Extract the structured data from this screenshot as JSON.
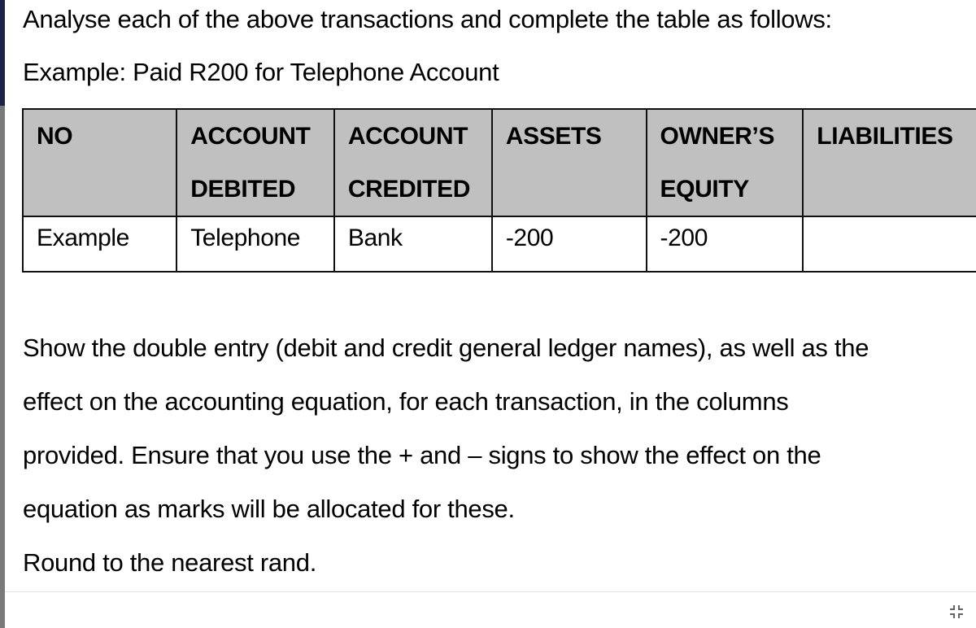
{
  "document": {
    "instruction": "Analyse each of the above transactions and complete the table as follows:",
    "example_caption": "Example: Paid R200 for Telephone Account",
    "table": {
      "headers": [
        [
          "NO",
          ""
        ],
        [
          "ACCOUNT",
          "DEBITED"
        ],
        [
          "ACCOUNT",
          "CREDITED"
        ],
        [
          "ASSETS",
          ""
        ],
        [
          "OWNER’S",
          "EQUITY"
        ],
        [
          "LIABILITIES",
          ""
        ]
      ],
      "rows": [
        [
          "Example",
          "Telephone",
          "Bank",
          "-200",
          "-200",
          ""
        ]
      ]
    },
    "paragraph_lines": [
      "Show the double entry (debit and credit general ledger names), as well as the",
      "effect on the accounting equation, for each transaction, in the columns",
      "provided. Ensure that you use the + and – signs to show the effect on the",
      "equation as marks will be allocated for these.",
      "Round to the nearest rand."
    ]
  },
  "viewer": {
    "exit_fullscreen_icon": "shrink-arrows-icon"
  }
}
